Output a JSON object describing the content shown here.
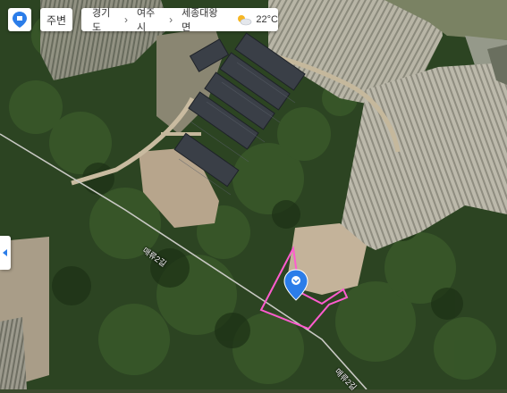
{
  "toolbar": {
    "home_icon": "map-home-icon",
    "nearby_label": "주변"
  },
  "breadcrumb": {
    "province": "경기도",
    "city": "여주시",
    "district": "세종대왕면",
    "separator_icon": "chevron-right-icon"
  },
  "weather": {
    "icon": "partly-cloudy-icon",
    "temperature": "22°C"
  },
  "side_panel_toggle": {
    "icon": "triangle-left-icon"
  },
  "road_labels": [
    "매류2길",
    "매류2길"
  ],
  "marker": {
    "icon": "location-pin-icon",
    "color": "#2b7de9"
  },
  "parcel_outline": {
    "color": "#ff5ccf"
  }
}
